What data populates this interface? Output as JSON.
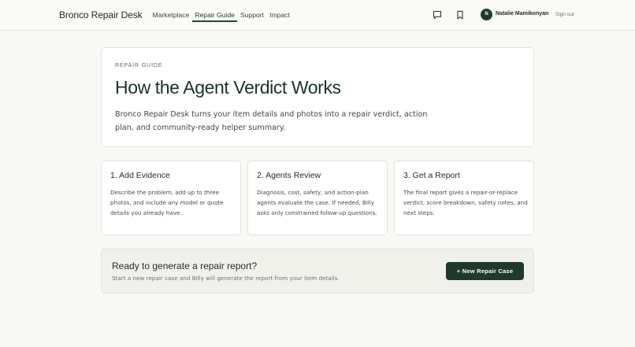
{
  "header": {
    "brand": "Bronco Repair Desk",
    "nav": [
      {
        "label": "Marketplace"
      },
      {
        "label": "Repair Guide",
        "active": true
      },
      {
        "label": "Support"
      },
      {
        "label": "Impact"
      }
    ],
    "icons": [
      "message-icon",
      "bookmark-icon"
    ],
    "user": {
      "initial": "N",
      "name": "Natalie Mamikonyan"
    },
    "sign_out": "Sign out"
  },
  "hero": {
    "eyebrow": "REPAIR GUIDE",
    "title": "How the Agent Verdict Works",
    "description": "Bronco Repair Desk turns your item details and photos into a repair verdict, action plan, and community-ready helper summary."
  },
  "steps": [
    {
      "title": "1. Add Evidence",
      "body": "Describe the problem, add up to three photos, and include any model or quote details you already have."
    },
    {
      "title": "2. Agents Review",
      "body": "Diagnosis, cost, safety, and action-plan agents evaluate the case. If needed, Billy asks only constrained follow-up questions."
    },
    {
      "title": "3. Get a Report",
      "body": "The final report gives a repair-or-replace verdict, score breakdown, safety notes, and next steps."
    }
  ],
  "cta": {
    "title": "Ready to generate a repair report?",
    "subtitle": "Start a new repair case and Billy will generate the report from your item details.",
    "button": "+ New Repair Case"
  },
  "colors": {
    "accent": "#1f3a2d",
    "background": "#f8f8f5",
    "card": "#ffffff"
  }
}
